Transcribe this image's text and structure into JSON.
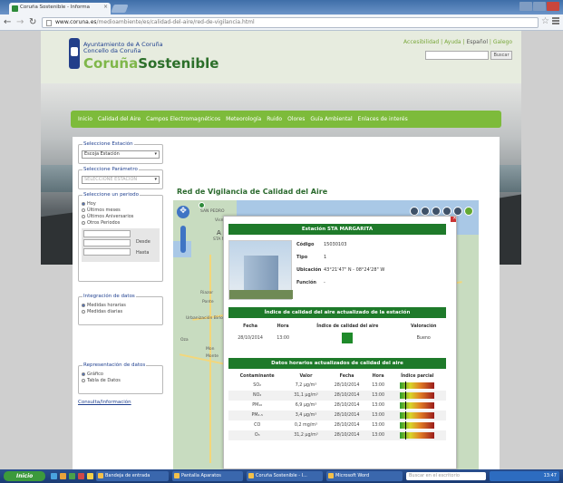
{
  "browser": {
    "tab_title": "Coruña Sostenible - Informa",
    "url_host": "www.coruna.es",
    "url_path": "/medioambiente/es/calidad-del-aire/red-de-vigilancia.html"
  },
  "header": {
    "org_line1": "Ayuntamiento de A Coruña",
    "org_line2": "Concello da Coruña",
    "brand_part1": "Coruña",
    "brand_part2": "Sostenible",
    "lang_links": "Accesibilidad | Ayuda | ",
    "lang_active": "Español",
    "lang_other": " | Galego",
    "search_button": "Buscar"
  },
  "nav": {
    "items": [
      "Inicio",
      "Calidad del Aire",
      "Campos Electromagnéticos",
      "Meteorología",
      "Ruido",
      "Olores",
      "Guía Ambiental",
      "Enlaces de interés"
    ]
  },
  "panel": {
    "estacion_legend": "Seleccione Estación",
    "estacion_value": "Escoja Estación",
    "parametro_legend": "Seleccione Parámetro",
    "parametro_value": "SELECCIONE ESTACIÓN",
    "periodo_legend": "Seleccione un periodo",
    "periodo_options": [
      "Hoy",
      "Últimos meses",
      "Últimos Aniversarios",
      "Otros Periodos"
    ],
    "desde_label": "Desde",
    "hasta_label": "Hasta",
    "integracion_legend": "Integración de datos",
    "integracion_options": [
      "Medidas horarias",
      "Medidas diarias"
    ],
    "representacion_legend": "Representación de datos",
    "representacion_options": [
      "Gráfico",
      "Tabla de Datos"
    ],
    "consult_link": "Consulta/Información"
  },
  "map": {
    "title": "Red de Vigilancia de Calidad del Aire",
    "labels": [
      "SAN PEDRO",
      "Visma",
      "A Coruña",
      "STA MARGARITA",
      "Riazor",
      "Ponte",
      "Urbanización Birloque",
      "Oza",
      "Mon",
      "Monte"
    ]
  },
  "popup": {
    "station_title": "Estación STA MARGARITA",
    "fields": [
      {
        "label": "Código",
        "value": "15030103"
      },
      {
        "label": "Tipo",
        "value": "1"
      },
      {
        "label": "Ubicación",
        "value": "43°21'47\" N - 08°24'28\" W"
      },
      {
        "label": "Función",
        "value": "-"
      }
    ],
    "index_title": "Índice de calidad del aire actualizado de la estación",
    "index_headers": [
      "Fecha",
      "Hora",
      "Índice de calidad del aire",
      "Valoración"
    ],
    "index_row": {
      "fecha": "28/10/2014",
      "hora": "13:00",
      "valoracion": "Bueno",
      "color": "#1f8a2a"
    },
    "hourly_title": "Datos horarios actualizados de calidad del aire",
    "hourly_headers": [
      "Contaminante",
      "Valor",
      "Fecha",
      "Hora",
      "Índice parcial"
    ],
    "hourly_rows": [
      {
        "pollutant": "SO₂",
        "value": "7,2 µg/m³",
        "date": "28/10/2014",
        "hour": "13:00"
      },
      {
        "pollutant": "NO₂",
        "value": "31,1 µg/m³",
        "date": "28/10/2014",
        "hour": "13:00"
      },
      {
        "pollutant": "PM₁₀",
        "value": "6,9 µg/m³",
        "date": "28/10/2014",
        "hour": "13:00"
      },
      {
        "pollutant": "PM₂.₅",
        "value": "3,4 µg/m³",
        "date": "28/10/2014",
        "hour": "13:00"
      },
      {
        "pollutant": "CO",
        "value": "0,2 mg/m³",
        "date": "28/10/2014",
        "hour": "13:00"
      },
      {
        "pollutant": "O₃",
        "value": "31,2 µg/m³",
        "date": "28/10/2014",
        "hour": "13:00"
      }
    ]
  },
  "taskbar": {
    "start_label": "Inicio",
    "buttons": [
      "Bandeja de entrada",
      "Pantalla Aparatos",
      "Coruña Sostenible - I...",
      "Microsoft Word"
    ],
    "search_placeholder": "Buscar en el escritorio",
    "clock": "13:47"
  },
  "colors": {
    "accent_green": "#7dbb3b",
    "dark_green": "#1e7a2a",
    "link_blue": "#1e3f8f"
  }
}
